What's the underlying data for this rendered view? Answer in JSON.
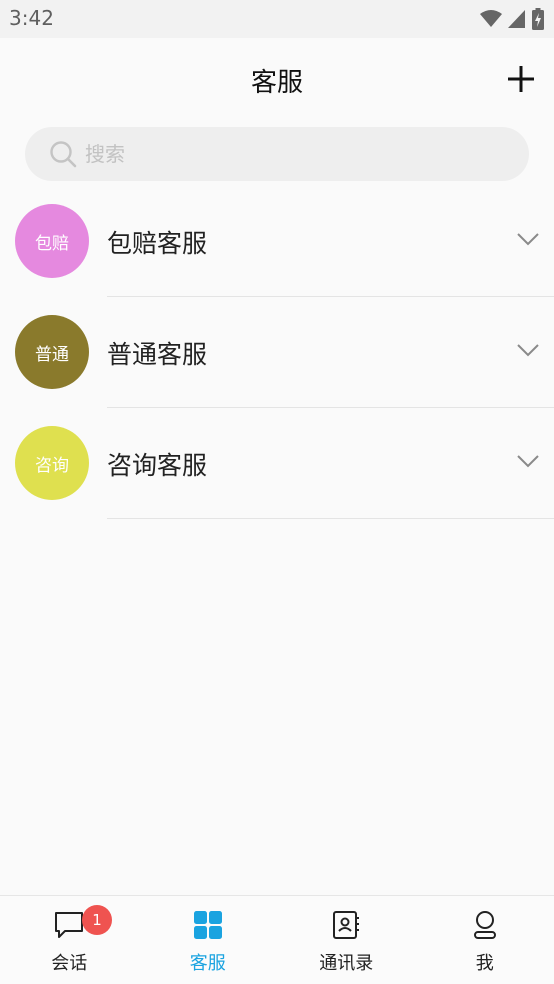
{
  "status_bar": {
    "time": "3:42",
    "icons": [
      "wifi-icon",
      "signal-icon",
      "battery-charging-icon"
    ]
  },
  "header": {
    "title": "客服",
    "add_icon": "plus-icon"
  },
  "search": {
    "placeholder": "搜索",
    "value": ""
  },
  "groups": [
    {
      "avatar_text": "包赔",
      "avatar_color": "#e589df",
      "name": "包赔客服"
    },
    {
      "avatar_text": "普通",
      "avatar_color": "#8a7a2c",
      "name": "普通客服"
    },
    {
      "avatar_text": "咨询",
      "avatar_color": "#dfe04f",
      "name": "咨询客服"
    }
  ],
  "bottom_nav": {
    "items": [
      {
        "label": "会话",
        "icon": "chat-icon",
        "badge": "1"
      },
      {
        "label": "客服",
        "icon": "grid-icon",
        "active": true
      },
      {
        "label": "通讯录",
        "icon": "contacts-book-icon"
      },
      {
        "label": "我",
        "icon": "person-icon"
      }
    ]
  },
  "colors": {
    "accent": "#1aa3e0",
    "badge": "#ef5350"
  }
}
